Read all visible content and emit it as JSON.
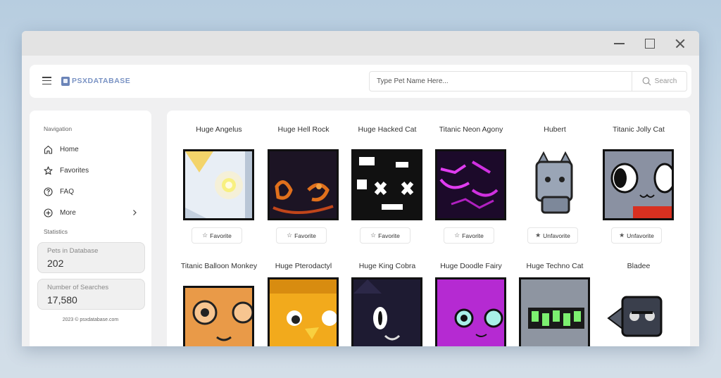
{
  "app": {
    "logo_text": "PSXDATABASE"
  },
  "search": {
    "placeholder": "Type Pet Name Here...",
    "button_label": "Search"
  },
  "sidebar": {
    "nav_title": "Navigation",
    "items": [
      {
        "label": "Home",
        "icon": "home-icon"
      },
      {
        "label": "Favorites",
        "icon": "star-icon"
      },
      {
        "label": "FAQ",
        "icon": "question-icon"
      },
      {
        "label": "More",
        "icon": "plus-circle-icon"
      }
    ],
    "stats_title": "Statistics",
    "stats": [
      {
        "label": "Pets in Database",
        "value": "202"
      },
      {
        "label": "Number of Searches",
        "value": "17,580"
      }
    ],
    "copyright": "2023 © psxdatabase.com"
  },
  "pets": [
    {
      "name": "Huge Angelus",
      "button": "Favorite",
      "favorited": false
    },
    {
      "name": "Huge Hell Rock",
      "button": "Favorite",
      "favorited": false
    },
    {
      "name": "Huge Hacked Cat",
      "button": "Favorite",
      "favorited": false
    },
    {
      "name": "Titanic Neon Agony",
      "button": "Favorite",
      "favorited": false
    },
    {
      "name": "Hubert",
      "button": "Unfavorite",
      "favorited": true
    },
    {
      "name": "Titanic Jolly Cat",
      "button": "Unfavorite",
      "favorited": true
    },
    {
      "name": "Titanic Balloon Monkey"
    },
    {
      "name": "Huge Pterodactyl"
    },
    {
      "name": "Huge King Cobra"
    },
    {
      "name": "Huge Doodle Fairy"
    },
    {
      "name": "Huge Techno Cat"
    },
    {
      "name": "Bladee"
    }
  ],
  "colors": {
    "accent": "#7a93c4",
    "panel": "#ffffff",
    "window_bg": "#f0f0f1"
  }
}
